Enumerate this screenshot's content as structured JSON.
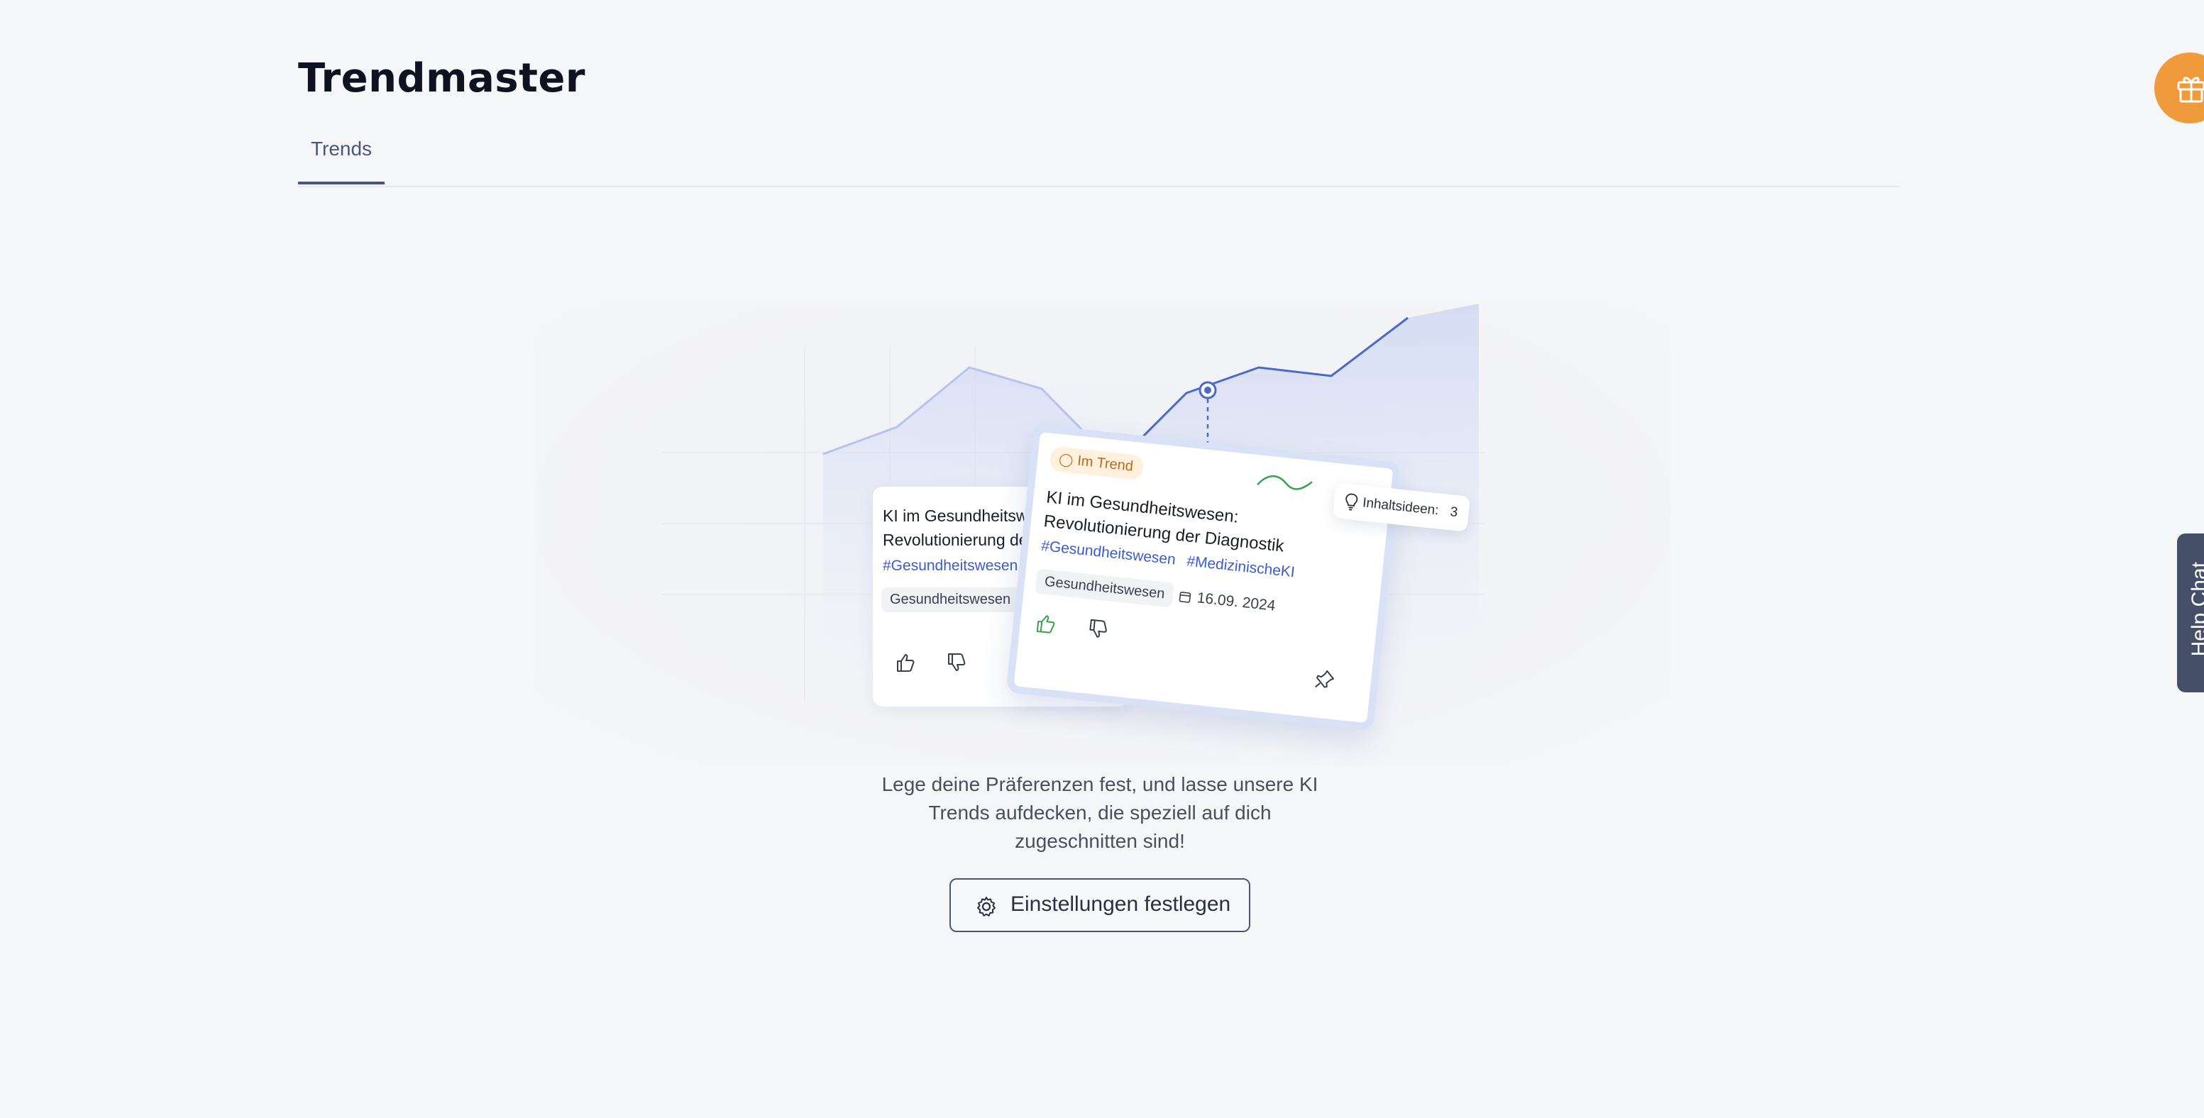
{
  "page": {
    "title": "Trendmaster"
  },
  "tabs": [
    {
      "label": "Trends",
      "active": true
    }
  ],
  "floating": {
    "gift_icon": "gift-icon",
    "help_chat_label": "Help Chat"
  },
  "illustration": {
    "back_card": {
      "title": "KI im Gesundheitswesen: Revolutionierung der Diagnostik",
      "hashtag": "#Gesundheitswesen",
      "category": "Gesundheitswesen"
    },
    "front_card": {
      "badge": "Im Trend",
      "title": "KI im Gesundheitswesen: Revolutionierung der Diagnostik",
      "hashtags": [
        "#Gesundheitswesen",
        "#MedizinischeKI"
      ],
      "category": "Gesundheitswesen",
      "date": "16.09. 2024"
    },
    "ideas": {
      "label": "Inhaltsideen:",
      "count": "3"
    }
  },
  "empty_state": {
    "message": "Lege deine Präferenzen fest, und lasse unsere KI Trends aufdecken, die speziell auf dich zugeschnitten sind!",
    "button_label": "Einstellungen festlegen"
  },
  "colors": {
    "accent": "#4a5777",
    "gift": "#ef9a3b",
    "help_chat": "#454f68",
    "hashtag": "#3b5bd0",
    "trend_badge_bg": "#fff1dd",
    "like_green": "#3aa04c"
  }
}
